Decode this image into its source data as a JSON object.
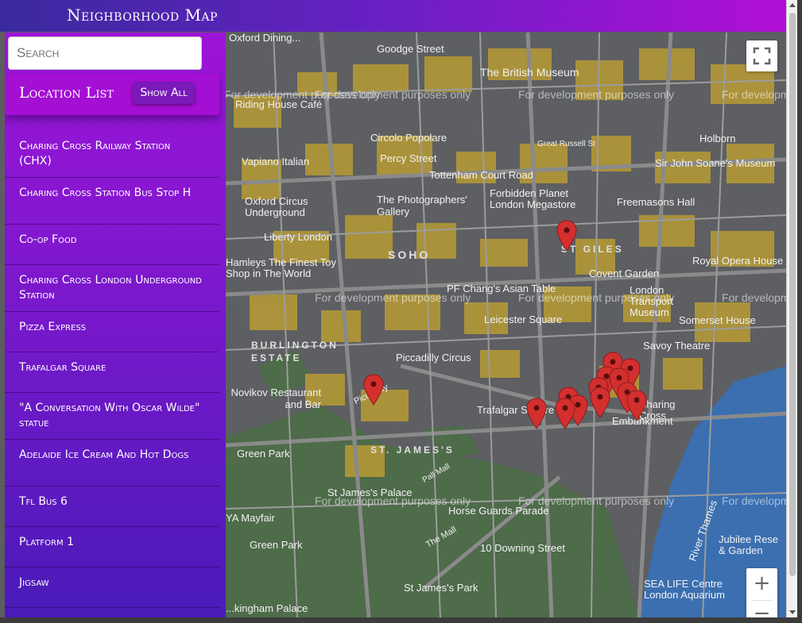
{
  "header": {
    "title": "Neighborhood Map"
  },
  "sidebar": {
    "search_placeholder": "Search",
    "list_title": "Location List",
    "show_all_label": "Show All",
    "items": [
      "Charing Cross Railway Station (CHX)",
      "Charing Cross Station Bus Stop H",
      "Co-op Food",
      "Charing Cross London Underground Station",
      "Pizza Express",
      "Trafalgar Square",
      "\"A Conversation With Oscar Wilde\" statue",
      "Adelaide Ice Cream And Hot Dogs",
      "Tfl Bus 6",
      "Platform 1",
      "Jigsaw"
    ]
  },
  "map": {
    "watermark": "For development purposes only",
    "labels": {
      "oxford_dining": "Oxford Dining...",
      "goodge_street": "Goodge Street",
      "british_museum": "The British Museum",
      "riding_house": "Riding House Café",
      "circolo": "Circolo Popolare",
      "great_russell": "Great Russell St",
      "holborn": "Holborn",
      "vapiano": "Vapiano Italian",
      "percy_street": "Percy Street",
      "tottenham_court": "Tottenham Court Road",
      "soane": "Sir John Soane's Museum",
      "oxford_circus": "Oxford Circus Underground",
      "photographers": "The Photographers' Gallery",
      "forbidden_planet": "Forbidden Planet London Megastore",
      "freemasons": "Freemasons Hall",
      "liberty": "Liberty London",
      "soho": "SOHO",
      "st_giles": "ST GILES",
      "royal_opera": "Royal Opera House",
      "hamleys": "Hamleys The Finest Toy Shop in The World",
      "covent_garden": "Covent Garden",
      "pf_changs": "PF Chang's Asian Table",
      "london_transport": "London Transport Museum",
      "leicester_square": "Leicester Square",
      "somerset": "Somerset House",
      "burlington": "BURLINGTON ESTATE",
      "savoy": "Savoy Theatre",
      "piccadilly_circus": "Piccadilly Circus",
      "novikov": "Novikov Restaurant and Bar",
      "trafalgar": "Trafalgar Square",
      "charing_cross": "Charing Cross",
      "embankment": "Embankment",
      "green_park_st": "Green Park",
      "st_james": "ST. JAMES'S",
      "pall_mall": "Pall Mall",
      "st_james_palace": "St James's Palace",
      "horse_guards": "Horse Guards Parade",
      "ya_mayfair": "YA Mayfair",
      "green_park": "Green Park",
      "downing": "10 Downing Street",
      "river_thames": "River Thames",
      "jubilee": "Jubilee Rese & Garden",
      "st_james_park": "St James's Park",
      "sea_life": "SEA LIFE Centre London Aquarium",
      "buckingham": "...kingham Palace",
      "piccadilly": "Piccadilly",
      "the_mall": "The Mall"
    },
    "controls": {
      "zoom_in": "+",
      "zoom_out": "−",
      "fullscreen_icon": "fullscreen-icon"
    }
  },
  "colors": {
    "header_start": "#3a2a9e",
    "header_end": "#b10fd6",
    "sidebar_top": "#9e14d8",
    "sidebar_bottom": "#4a1bb8",
    "pin": "#d32f2f",
    "roads_major": "#c9a63a",
    "water": "#3b6fb0"
  }
}
